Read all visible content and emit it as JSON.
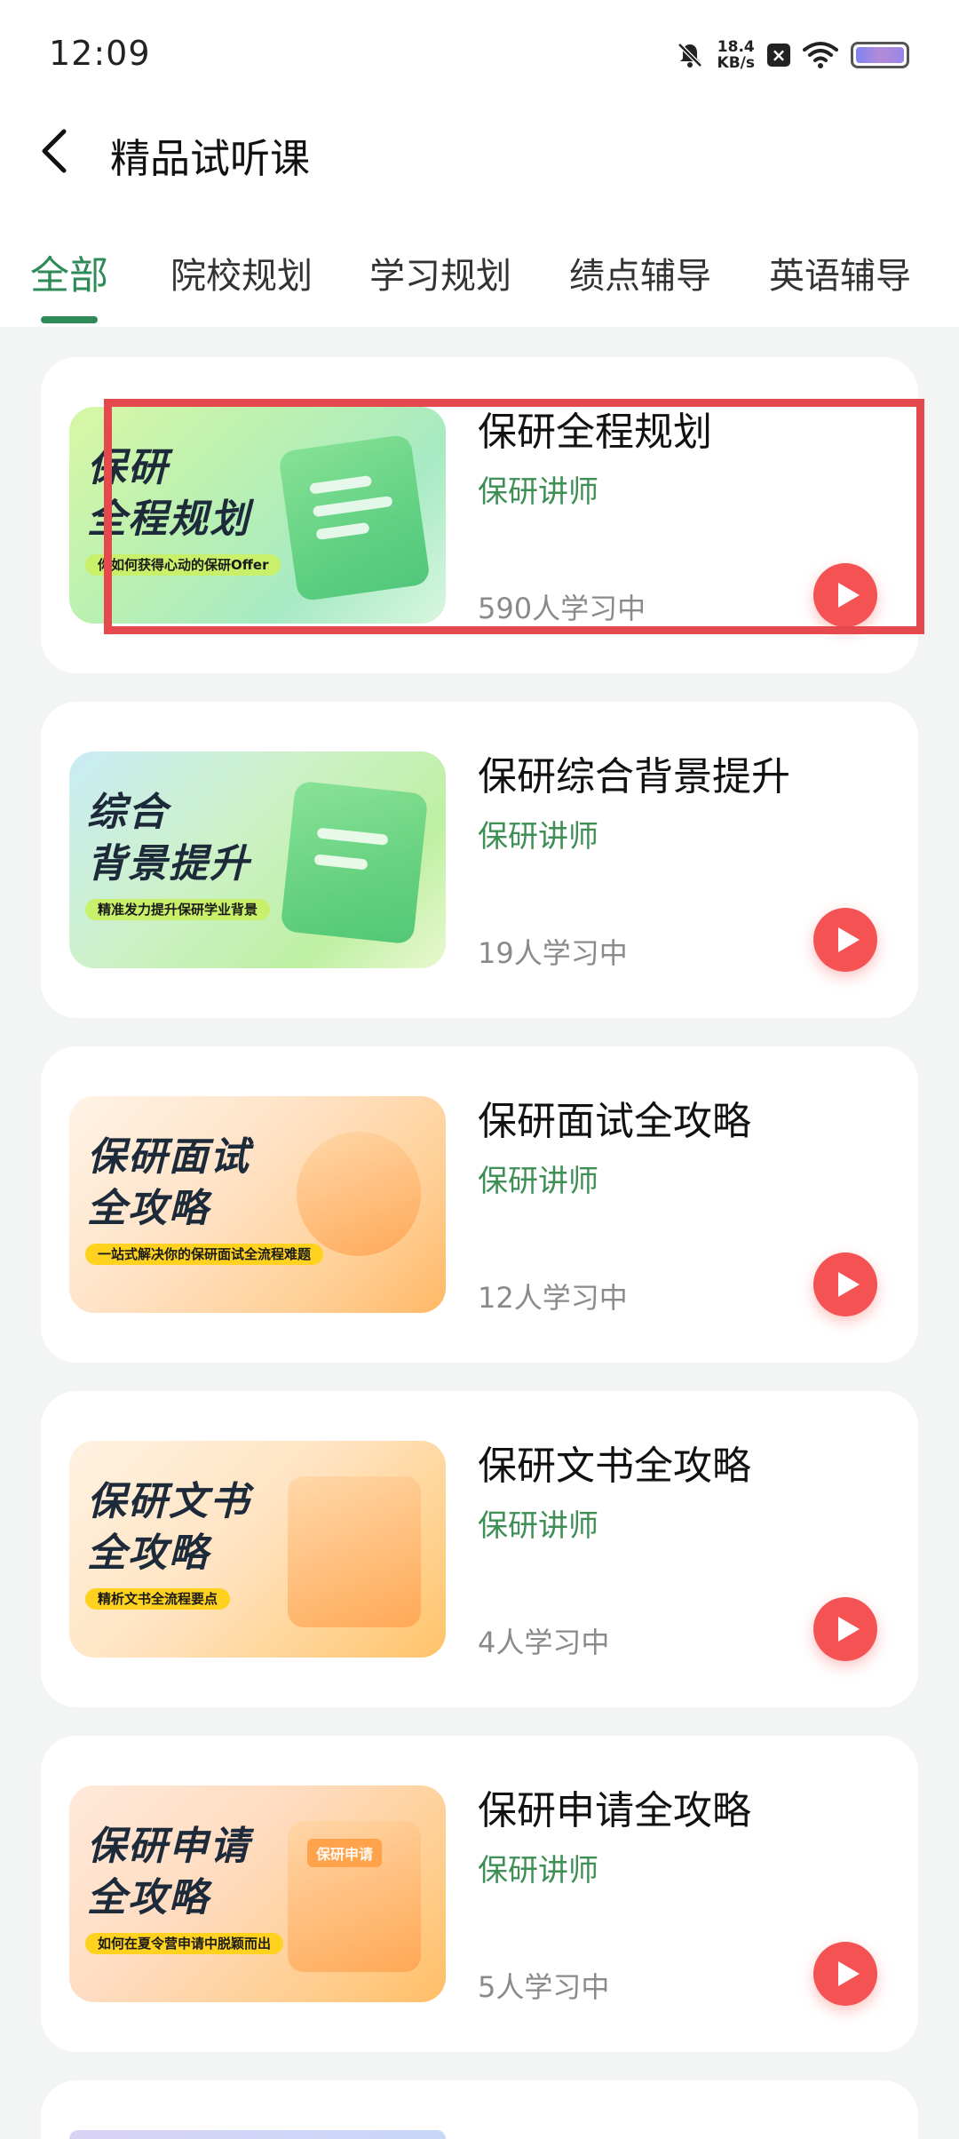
{
  "status_bar": {
    "time": "12:09",
    "network_speed_value": "18.4",
    "network_speed_unit": "KB/s"
  },
  "header": {
    "title": "精品试听课"
  },
  "tabs": [
    {
      "label": "全部",
      "active": true
    },
    {
      "label": "院校规划",
      "active": false
    },
    {
      "label": "学习规划",
      "active": false
    },
    {
      "label": "绩点辅导",
      "active": false
    },
    {
      "label": "英语辅导",
      "active": false
    }
  ],
  "courses": [
    {
      "title": "保研全程规划",
      "instructor": "保研讲师",
      "learners": "590人学习中",
      "thumb_line1": "保研",
      "thumb_line2": "全程规划",
      "thumb_subtitle": "你如何获得心动的保研Offer"
    },
    {
      "title": "保研综合背景提升",
      "instructor": "保研讲师",
      "learners": "19人学习中",
      "thumb_line1": "综合",
      "thumb_line2": "背景提升",
      "thumb_subtitle": "精准发力提升保研学业背景"
    },
    {
      "title": "保研面试全攻略",
      "instructor": "保研讲师",
      "learners": "12人学习中",
      "thumb_line1": "保研面试",
      "thumb_line2": "全攻略",
      "thumb_subtitle": "一站式解决你的保研面试全流程难题"
    },
    {
      "title": "保研文书全攻略",
      "instructor": "保研讲师",
      "learners": "4人学习中",
      "thumb_line1": "保研文书",
      "thumb_line2": "全攻略",
      "thumb_subtitle": "精析文书全流程要点"
    },
    {
      "title": "保研申请全攻略",
      "instructor": "保研讲师",
      "learners": "5人学习中",
      "thumb_line1": "保研申请",
      "thumb_line2": "全攻略",
      "thumb_subtitle": "如何在夏令营申请中脱颖而出",
      "thumb_badge": "保研申请"
    }
  ],
  "colors": {
    "accent_green": "#2e8b57",
    "play_red": "#f55353",
    "highlight_red": "#e5484d"
  }
}
